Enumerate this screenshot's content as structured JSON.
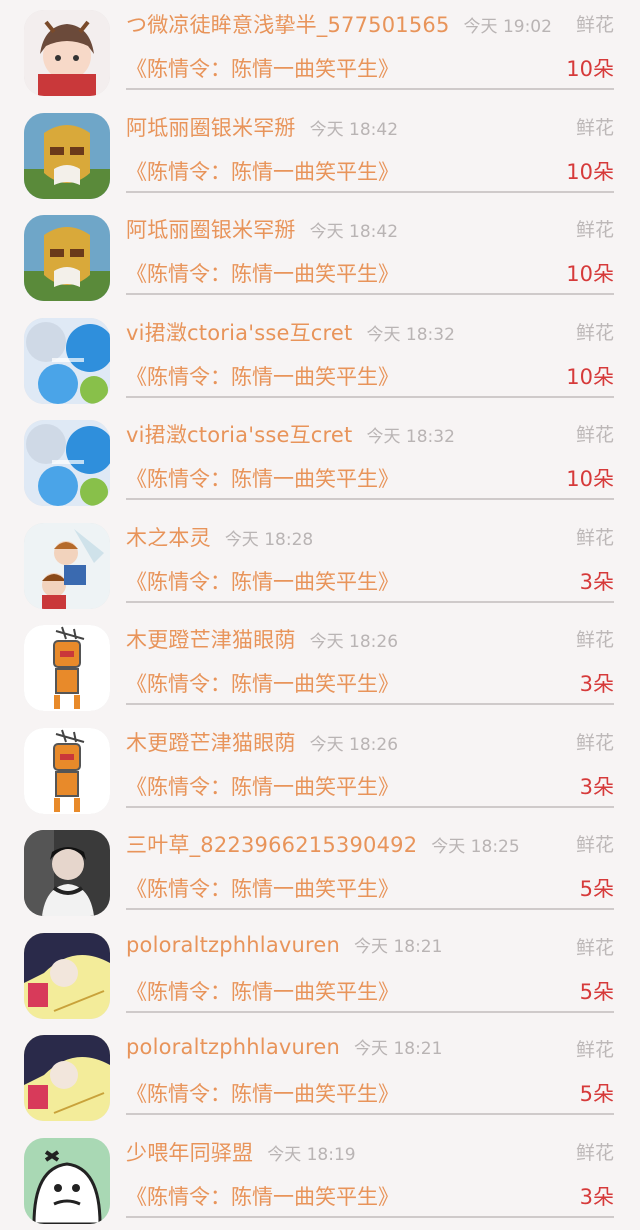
{
  "gift_records": [
    {
      "name": "つ微凉徒眸意浅挚半_577501565",
      "time": "今天 19:02",
      "type": "鲜花",
      "book": "《陈情令：陈情一曲笑平生》",
      "amount": "10朵",
      "avatar": "anime-girl-avatar"
    },
    {
      "name": "阿坻丽圈银米罕掰",
      "time": "今天 18:42",
      "type": "鲜花",
      "book": "《陈情令：陈情一曲笑平生》",
      "amount": "10朵",
      "avatar": "mask-avatar"
    },
    {
      "name": "阿坻丽圈银米罕掰",
      "time": "今天 18:42",
      "type": "鲜花",
      "book": "《陈情令：陈情一曲笑平生》",
      "amount": "10朵",
      "avatar": "mask-avatar"
    },
    {
      "name": "vi捃澂ctoria'sse互cret",
      "time": "今天 18:32",
      "type": "鲜花",
      "book": "《陈情令：陈情一曲笑平生》",
      "amount": "10朵",
      "avatar": "balloon-avatar"
    },
    {
      "name": "vi捃澂ctoria'sse互cret",
      "time": "今天 18:32",
      "type": "鲜花",
      "book": "《陈情令：陈情一曲笑平生》",
      "amount": "10朵",
      "avatar": "balloon-avatar"
    },
    {
      "name": "木之本灵",
      "time": "今天 18:28",
      "type": "鲜花",
      "book": "《陈情令：陈情一曲笑平生》",
      "amount": "3朵",
      "avatar": "anime-boy-avatar"
    },
    {
      "name": "木更蹬芒津猫眼荫",
      "time": "今天 18:26",
      "type": "鲜花",
      "book": "《陈情令：陈情一曲笑平生》",
      "amount": "3朵",
      "avatar": "robot-avatar"
    },
    {
      "name": "木更蹬芒津猫眼荫",
      "time": "今天 18:26",
      "type": "鲜花",
      "book": "《陈情令：陈情一曲笑平生》",
      "amount": "3朵",
      "avatar": "robot-avatar"
    },
    {
      "name": "三叶草_8223966215390492",
      "time": "今天 18:25",
      "type": "鲜花",
      "book": "《陈情令：陈情一曲笑平生》",
      "amount": "5朵",
      "avatar": "photo-boy-avatar"
    },
    {
      "name": "poloraltzphhlavuren",
      "time": "今天 18:21",
      "type": "鲜花",
      "book": "《陈情令：陈情一曲笑平生》",
      "amount": "5朵",
      "avatar": "sketch-boy-avatar"
    },
    {
      "name": "poloraltzphhlavuren",
      "time": "今天 18:21",
      "type": "鲜花",
      "book": "《陈情令：陈情一曲笑平生》",
      "amount": "5朵",
      "avatar": "sketch-boy-avatar"
    },
    {
      "name": "少喂年同驿盟",
      "time": "今天 18:19",
      "type": "鲜花",
      "book": "《陈情令：陈情一曲笑平生》",
      "amount": "3朵",
      "avatar": "gorilla-avatar"
    }
  ],
  "colors": {
    "name_orange": "#e8945a",
    "amount_red": "#d63a3a",
    "muted_gray": "#b9b4b4",
    "background": "#f7f4f4"
  }
}
